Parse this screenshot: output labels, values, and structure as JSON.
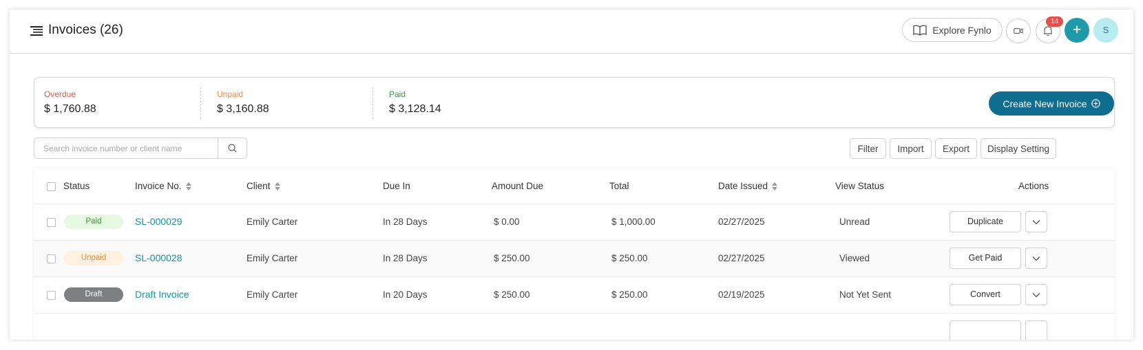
{
  "header": {
    "title": "Invoices (26)",
    "explore_label": "Explore Fynlo",
    "notification_count": "14",
    "add_label": "+",
    "avatar_initial": "S"
  },
  "summary": {
    "overdue": {
      "label": "Overdue",
      "value": "$ 1,760.88",
      "color": "#e05a4f"
    },
    "unpaid": {
      "label": "Unpaid",
      "value": "$ 3,160.88",
      "color": "#ee8f46"
    },
    "paid": {
      "label": "Paid",
      "value": "$ 3,128.14",
      "color": "#3a9a4a"
    },
    "create_label": "Create New Invoice"
  },
  "toolbar": {
    "search_placeholder": "Search invoice number or client name",
    "filter": "Filter",
    "import": "Import",
    "export": "Export",
    "display_setting": "Display Setting"
  },
  "table": {
    "headers": {
      "status": "Status",
      "invoice_no": "Invoice No.",
      "client": "Client",
      "due_in": "Due In",
      "amount_due": "Amount Due",
      "total": "Total",
      "date_issued": "Date Issued",
      "view_status": "View Status",
      "actions": "Actions"
    },
    "rows": [
      {
        "status": "Paid",
        "invoice_no": "SL-000029",
        "client": "Emily Carter",
        "due_in": "In 28 Days",
        "amount_due": "$ 0.00",
        "total": "$ 1,000.00",
        "date_issued": "02/27/2025",
        "view_status": "Unread",
        "action": "Duplicate"
      },
      {
        "status": "Unpaid",
        "invoice_no": "SL-000028",
        "client": "Emily Carter",
        "due_in": "In 28 Days",
        "amount_due": "$ 250.00",
        "total": "$ 250.00",
        "date_issued": "02/27/2025",
        "view_status": "Viewed",
        "action": "Get Paid"
      },
      {
        "status": "Draft",
        "invoice_no": "Draft Invoice",
        "client": "Emily Carter",
        "due_in": "In 20 Days",
        "amount_due": "$ 250.00",
        "total": "$ 250.00",
        "date_issued": "02/19/2025",
        "view_status": "Not Yet Sent",
        "action": "Convert"
      }
    ]
  }
}
